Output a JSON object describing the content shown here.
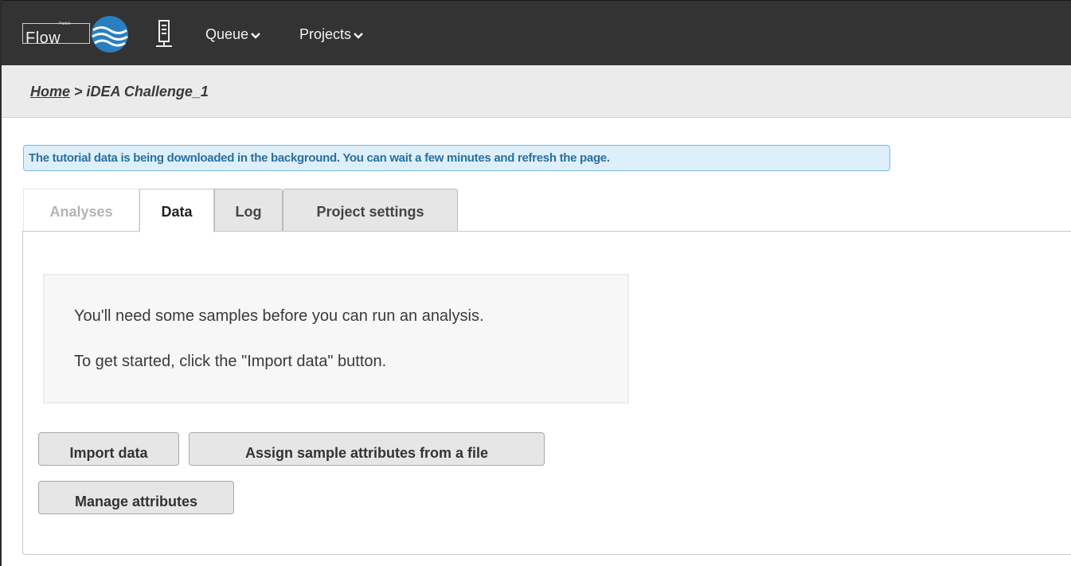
{
  "app": {
    "logo_text": "Flow",
    "logo_subtext": "Partek",
    "accent": "#2a7fc0",
    "navbar_bg": "#333333"
  },
  "nav": {
    "server_icon": "server-icon",
    "items": [
      {
        "label": "Queue",
        "icon": "chevron-down-icon"
      },
      {
        "label": "Projects",
        "icon": "chevron-down-icon"
      }
    ]
  },
  "breadcrumb": {
    "home": "Home",
    "separator": " > ",
    "current": "iDEA Challenge_1"
  },
  "alert": {
    "text": "The tutorial data is being downloaded in the background. You can wait a few minutes and refresh the page."
  },
  "tabs": [
    {
      "label": "Analyses",
      "state": "disabled"
    },
    {
      "label": "Data",
      "state": "active"
    },
    {
      "label": "Log",
      "state": "inactive"
    },
    {
      "label": "Project settings",
      "state": "inactive"
    }
  ],
  "empty_state": {
    "line1": "You'll need some samples before you can run an analysis.",
    "line2": "To get started, click the \"Import data\" button."
  },
  "buttons": {
    "import": "Import data",
    "assign": "Assign sample attributes from a file",
    "manage": "Manage attributes"
  }
}
